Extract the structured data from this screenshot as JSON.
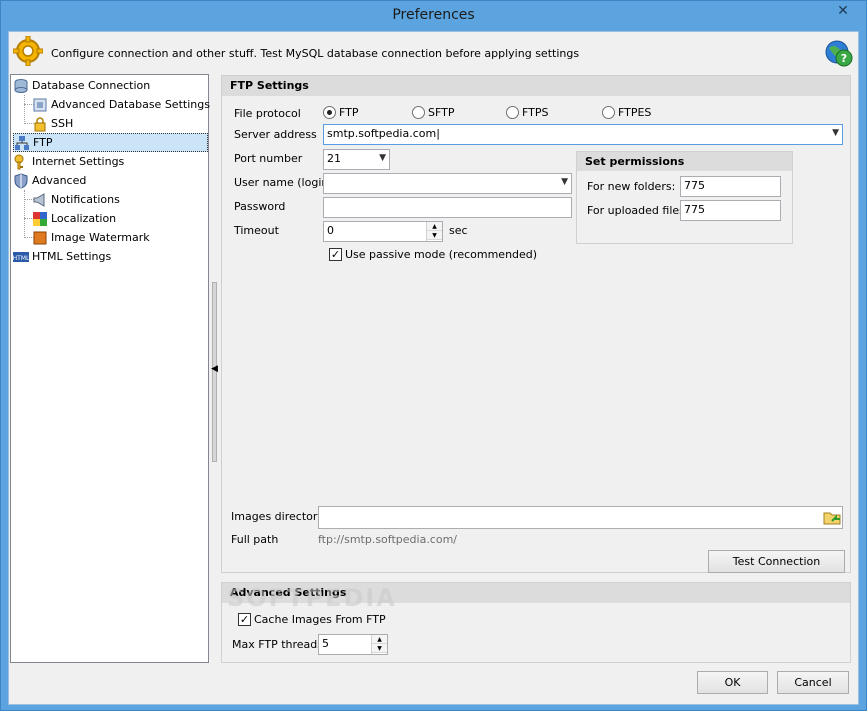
{
  "window": {
    "title": "Preferences"
  },
  "header": {
    "text": "Configure connection and other stuff. Test MySQL database connection before applying settings"
  },
  "tree": {
    "items": [
      {
        "label": "Database Connection"
      },
      {
        "label": "Advanced Database Settings"
      },
      {
        "label": "SSH"
      },
      {
        "label": "FTP"
      },
      {
        "label": "Internet Settings"
      },
      {
        "label": "Advanced"
      },
      {
        "label": "Notifications"
      },
      {
        "label": "Localization"
      },
      {
        "label": "Image Watermark"
      },
      {
        "label": "HTML Settings"
      }
    ],
    "selected": "FTP"
  },
  "ftp": {
    "section_title": "FTP Settings",
    "file_protocol_label": "File protocol",
    "protocols": [
      "FTP",
      "SFTP",
      "FTPS",
      "FTPES"
    ],
    "selected_protocol": "FTP",
    "server_label": "Server address",
    "server_value": "smtp.softpedia.com",
    "port_label": "Port number",
    "port_value": "21",
    "user_label": "User name (login)",
    "user_value": "",
    "password_label": "Password",
    "password_value": "",
    "timeout_label": "Timeout",
    "timeout_value": "0",
    "timeout_unit": "sec",
    "passive_label": "Use passive mode (recommended)",
    "passive_checked": true,
    "images_dir_label": "Images directory",
    "images_dir_value": "",
    "full_path_label": "Full path",
    "full_path_value": "ftp://smtp.softpedia.com/",
    "test_button": "Test Connection"
  },
  "permissions": {
    "title": "Set permissions",
    "folders_label": "For new folders:",
    "folders_value": "775",
    "files_label": "For uploaded files:",
    "files_value": "775"
  },
  "advanced": {
    "title": "Advanced Settings",
    "cache_label": "Cache Images From FTP",
    "cache_checked": true,
    "threads_label": "Max FTP threads",
    "threads_value": "5"
  },
  "footer": {
    "ok": "OK",
    "cancel": "Cancel"
  },
  "watermark": "SOFTPEDIA"
}
